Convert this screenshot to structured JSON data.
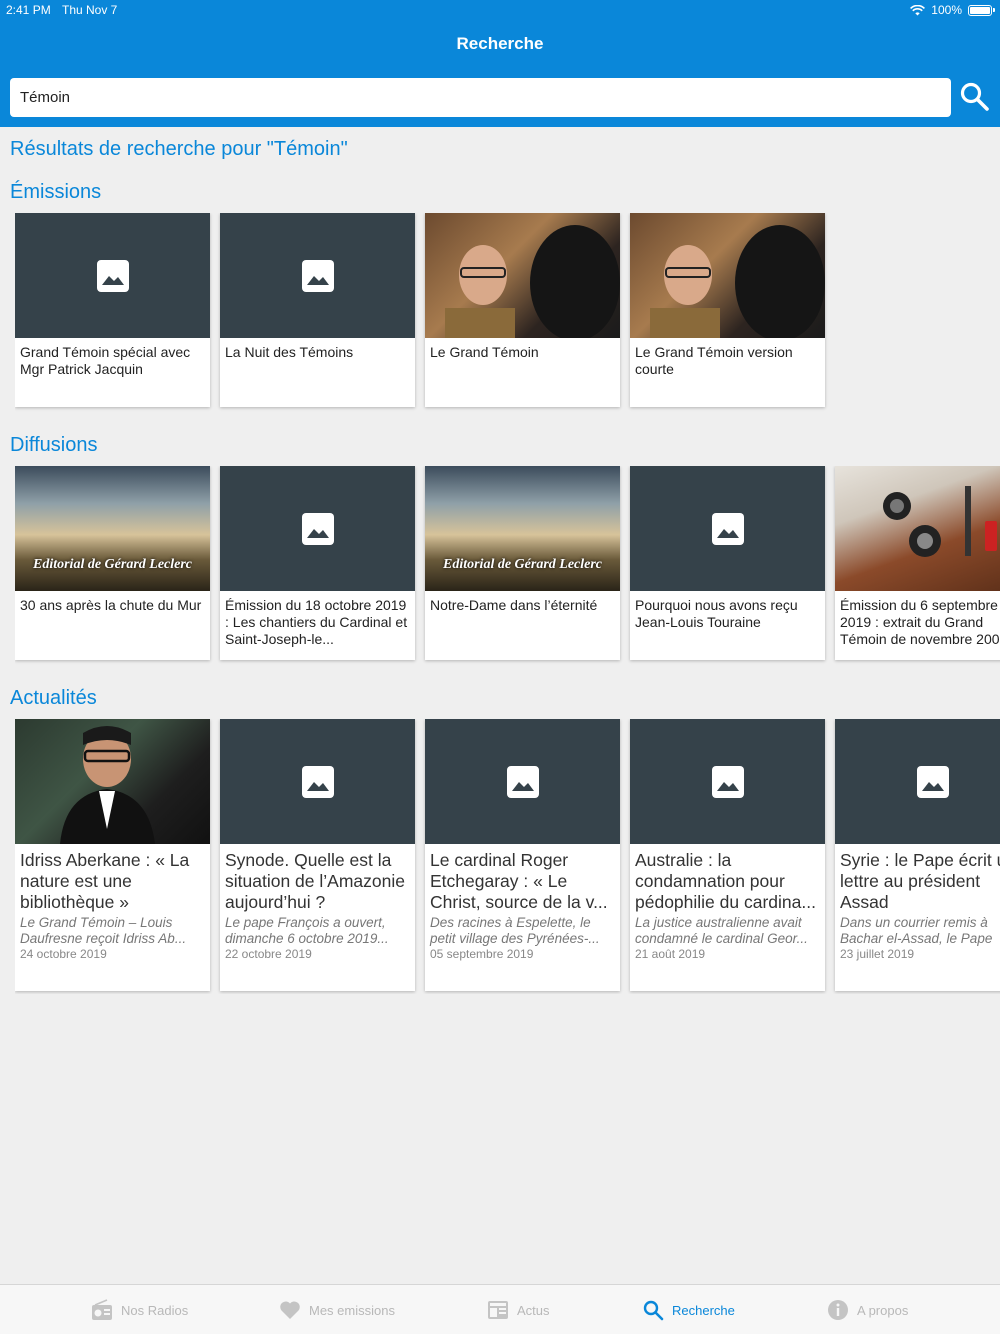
{
  "status": {
    "time": "2:41 PM",
    "date": "Thu Nov 7",
    "battery": "100%"
  },
  "nav": {
    "title": "Recherche"
  },
  "search": {
    "value": "Témoin",
    "icon": "search-icon"
  },
  "results_title": "Résultats de recherche pour \"Témoin\"",
  "sections": {
    "emissions": {
      "title": "Émissions",
      "items": [
        {
          "title": "Grand Témoin spécial avec Mgr Patrick Jacquin",
          "image": "placeholder"
        },
        {
          "title": "La Nuit des Témoins",
          "image": "placeholder"
        },
        {
          "title": "Le Grand Témoin",
          "image": "photo"
        },
        {
          "title": "Le Grand Témoin version courte",
          "image": "photo"
        }
      ]
    },
    "diffusions": {
      "title": "Diffusions",
      "items": [
        {
          "title": "30 ans après la chute du Mur",
          "image": "photo",
          "overlay": "Editorial de Gérard Leclerc"
        },
        {
          "title": "Émission du 18 octobre 2019 : Les chantiers du Cardinal et Saint-Joseph-le...",
          "image": "placeholder"
        },
        {
          "title": "Notre-Dame dans l’éternité",
          "image": "photo",
          "overlay": "Editorial de Gérard Leclerc"
        },
        {
          "title": "Pourquoi nous avons reçu Jean-Louis Touraine",
          "image": "placeholder"
        },
        {
          "title": "Émission du 6 septembre 2019 : extrait du Grand Témoin de novembre 200",
          "image": "photo"
        }
      ]
    },
    "actualites": {
      "title": "Actualités",
      "items": [
        {
          "title": "Idriss Aberkane : « La nature est une bibliothèque »",
          "desc": "Le Grand Témoin – Louis Daufresne reçoit Idriss Ab...",
          "date": "24 octobre 2019",
          "image": "photo"
        },
        {
          "title": "Synode. Quelle est la situation de l’Amazonie aujourd’hui ?",
          "desc": "Le pape François a ouvert, dimanche 6 octobre 2019...",
          "date": "22 octobre 2019",
          "image": "placeholder"
        },
        {
          "title": "Le cardinal Roger Etchegaray : « Le Christ, source de la v...",
          "desc": "Des racines à Espelette, le petit village des Pyrénées-...",
          "date": "05 septembre 2019",
          "image": "placeholder"
        },
        {
          "title": "Australie : la condamnation pour pédophilie du cardina...",
          "desc": "La justice australienne avait condamné le cardinal Geor...",
          "date": "21 août 2019",
          "image": "placeholder"
        },
        {
          "title": "Syrie : le Pape écrit u lettre au président Assad",
          "desc": "Dans un courrier remis à Bachar el-Assad, le Pape",
          "date": "23 juillet 2019",
          "image": "placeholder"
        }
      ]
    }
  },
  "tabs": [
    {
      "label": "Nos Radios",
      "icon": "radio-icon",
      "active": false
    },
    {
      "label": "Mes emissions",
      "icon": "heart-icon",
      "active": false
    },
    {
      "label": "Actus",
      "icon": "news-icon",
      "active": false
    },
    {
      "label": "Recherche",
      "icon": "search-icon",
      "active": true
    },
    {
      "label": "A propos",
      "icon": "info-icon",
      "active": false
    }
  ],
  "colors": {
    "primary": "#0a87d9",
    "placeholder_bg": "#35424a",
    "background": "#efefef"
  }
}
